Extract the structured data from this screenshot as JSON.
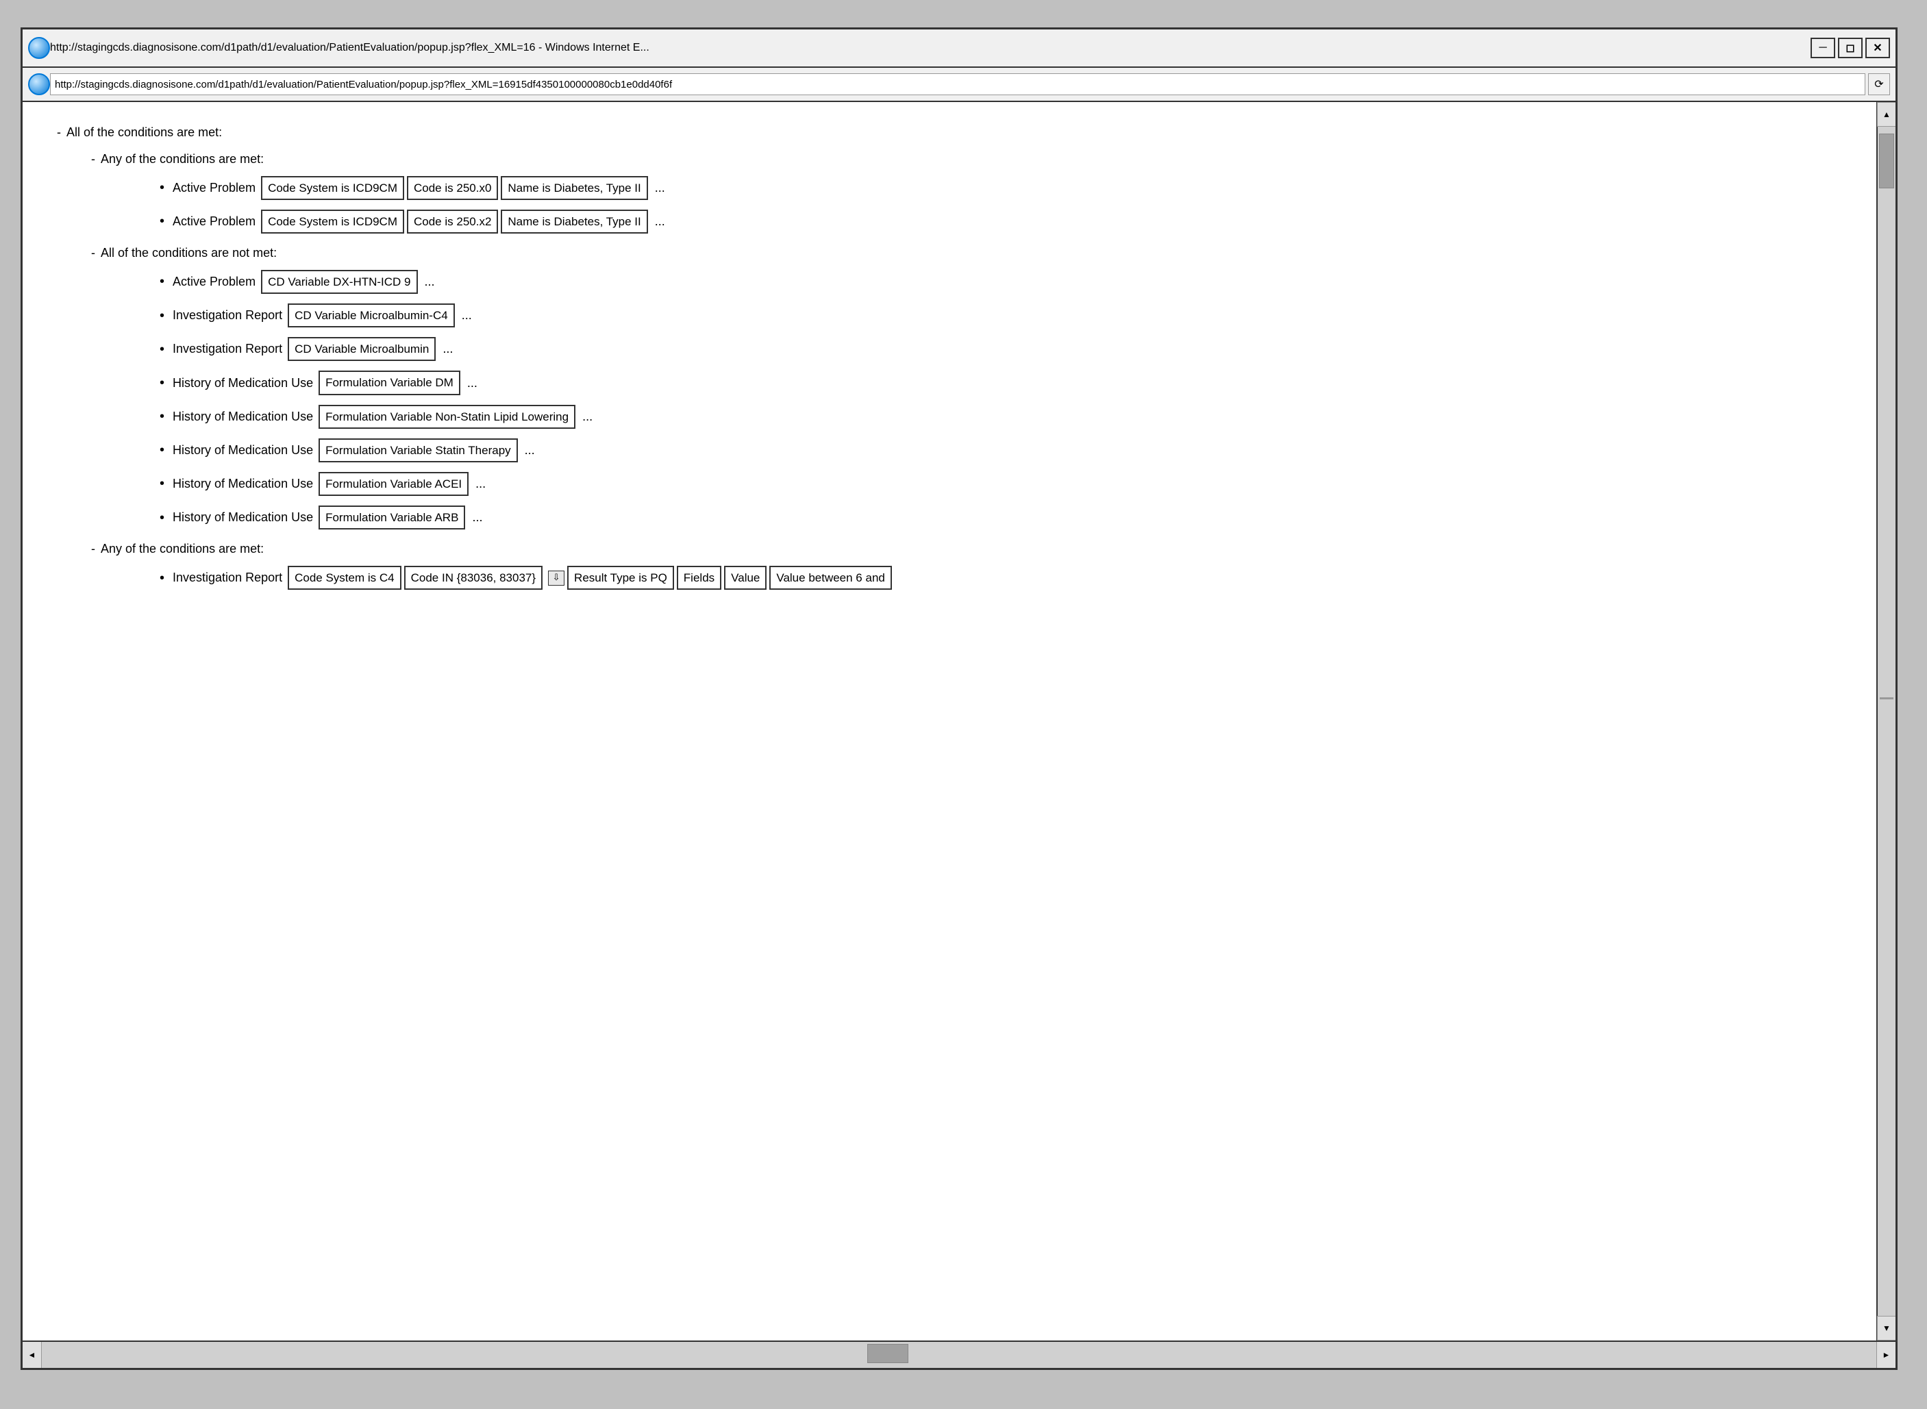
{
  "browser": {
    "title_url": "http://stagingcds.diagnosisone.com/d1path/d1/evaluation/PatientEvaluation/popup.jsp?flex_XML=16 - Windows Internet E...",
    "address_url": "http://stagingcds.diagnosisone.com/d1path/d1/evaluation/PatientEvaluation/popup.jsp?flex_XML=16915df4350100000080cb1e0dd40f6f",
    "minimize_label": "─",
    "restore_label": "◻",
    "close_label": "✕"
  },
  "content": {
    "level0_label": "All of the conditions are met:",
    "level1_any1_label": "Any of the conditions are met:",
    "level1_not_label": "All of the conditions are not met:",
    "level1_any2_label": "Any of the conditions are met:",
    "items_any1": [
      {
        "type": "Active Problem",
        "tags": [
          "Code System is ICD9CM",
          "Code is 250.x0",
          "Name is Diabetes, Type II"
        ],
        "ellipsis": "..."
      },
      {
        "type": "Active Problem",
        "tags": [
          "Code System is ICD9CM",
          "Code is 250.x2",
          "Name is Diabetes, Type II"
        ],
        "ellipsis": "..."
      }
    ],
    "items_not": [
      {
        "type": "Active Problem",
        "tags": [
          "CD Variable DX-HTN-ICD 9"
        ],
        "ellipsis": "..."
      },
      {
        "type": "Investigation Report",
        "tags": [
          "CD Variable Microalbumin-C4"
        ],
        "ellipsis": "..."
      },
      {
        "type": "Investigation Report",
        "tags": [
          "CD Variable Microalbumin"
        ],
        "ellipsis": "..."
      },
      {
        "type": "History of Medication Use",
        "tags": [
          "Formulation Variable DM"
        ],
        "ellipsis": "..."
      },
      {
        "type": "History of Medication Use",
        "tags": [
          "Formulation Variable Non-Statin Lipid Lowering"
        ],
        "ellipsis": "..."
      },
      {
        "type": "History of Medication Use",
        "tags": [
          "Formulation Variable Statin Therapy"
        ],
        "ellipsis": "..."
      },
      {
        "type": "History of Medication Use",
        "tags": [
          "Formulation Variable ACEI"
        ],
        "ellipsis": "..."
      },
      {
        "type": "History of Medication Use",
        "tags": [
          "Formulation Variable ARB"
        ],
        "ellipsis": "..."
      }
    ],
    "items_any2": [
      {
        "type": "Investigation Report",
        "tags": [
          "Code System is C4",
          "Code IN {83036, 83037}"
        ],
        "icon": true,
        "extra_tags": [
          "Result Type is PQ",
          "Fields",
          "Value",
          "Value between 6 and"
        ],
        "ellipsis": ""
      }
    ]
  }
}
